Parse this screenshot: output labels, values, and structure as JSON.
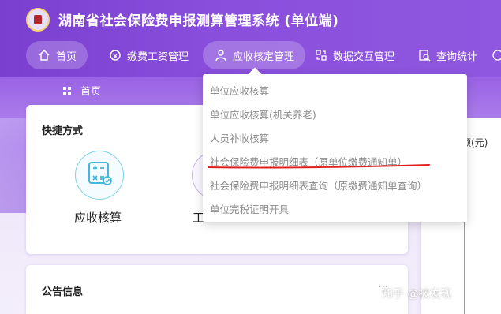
{
  "app": {
    "title": "湖南省社会保险费申报测算管理系统 (单位端)"
  },
  "nav": {
    "items": [
      {
        "label": "首页",
        "icon": "home-icon"
      },
      {
        "label": "缴费工资管理",
        "icon": "payroll-icon"
      },
      {
        "label": "应收核定管理",
        "icon": "user-icon"
      },
      {
        "label": "数据交互管理",
        "icon": "data-exchange-icon"
      },
      {
        "label": "查询统计",
        "icon": "search-stats-icon"
      }
    ]
  },
  "breadcrumb": {
    "label": "首页"
  },
  "quick": {
    "title": "快捷方式",
    "items": [
      {
        "label": "应收核算",
        "icon": "calculator-icon"
      },
      {
        "label": "工"
      }
    ]
  },
  "notice": {
    "title": "公告信息",
    "more": "···"
  },
  "right_panel": {
    "label": "额(元)"
  },
  "dropdown": {
    "items": [
      {
        "label": "单位应收核算"
      },
      {
        "label": "单位应收核算(机关养老)"
      },
      {
        "label": "人员补收核算"
      },
      {
        "label": "社会保险费申报明细表（原单位缴费通知单）"
      },
      {
        "label": "社会保险费申报明细表查询（原缴费通知单查询）"
      },
      {
        "label": "单位完税证明开具"
      }
    ]
  },
  "watermark": {
    "text": "知乎 @被发现"
  },
  "colors": {
    "accent": "#8a4fdc",
    "annotation": "#e0201f",
    "circle_border": "#7fd0ea"
  }
}
